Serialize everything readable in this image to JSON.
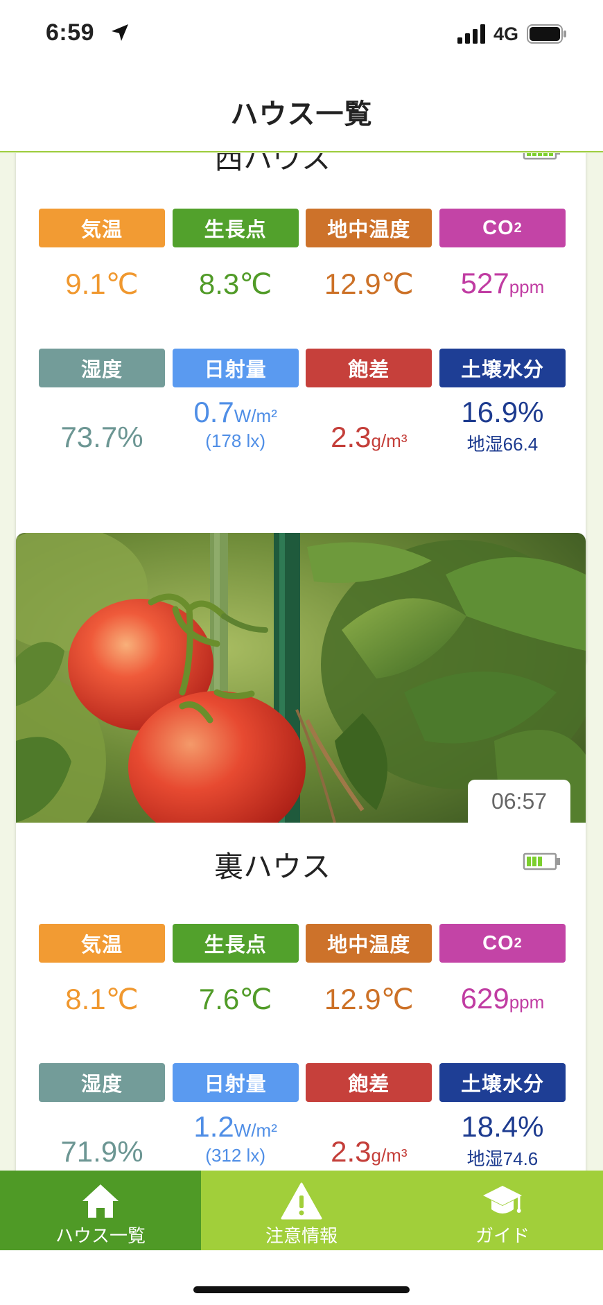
{
  "status_bar": {
    "time": "6:59",
    "network": "4G"
  },
  "header": {
    "title": "ハウス一覧"
  },
  "houses": [
    {
      "name": "西ハウス",
      "battery_level": 1.0,
      "labels": {
        "air_temp": "気温",
        "growth_point": "生長点",
        "ground_temp": "地中温度",
        "co2": "CO",
        "co2_sub": "2",
        "humidity": "湿度",
        "solar": "日射量",
        "saturation": "飽差",
        "soil_moisture": "土壌水分"
      },
      "values": {
        "air_temp": "9.1℃",
        "growth_point": "8.3℃",
        "ground_temp": "12.9℃",
        "co2": "527",
        "co2_unit": "ppm",
        "humidity": "73.7%",
        "solar": "0.7",
        "solar_unit": "W/m²",
        "solar_lux": "(178 lx)",
        "saturation": "2.3",
        "saturation_unit": "g/m³",
        "soil_moisture": "16.9%",
        "soil_sub": "地湿66.4"
      }
    },
    {
      "name": "裏ハウス",
      "battery_level": 0.6,
      "photo_time": "06:57",
      "labels": {
        "air_temp": "気温",
        "growth_point": "生長点",
        "ground_temp": "地中温度",
        "co2": "CO",
        "co2_sub": "2",
        "humidity": "湿度",
        "solar": "日射量",
        "saturation": "飽差",
        "soil_moisture": "土壌水分"
      },
      "values": {
        "air_temp": "8.1℃",
        "growth_point": "7.6℃",
        "ground_temp": "12.9℃",
        "co2": "629",
        "co2_unit": "ppm",
        "humidity": "71.9%",
        "solar": "1.2",
        "solar_unit": "W/m²",
        "solar_lux": "(312 lx)",
        "saturation": "2.3",
        "saturation_unit": "g/m³",
        "soil_moisture": "18.4%",
        "soil_sub": "地湿74.6"
      }
    }
  ],
  "tabs": [
    {
      "label": "ハウス一覧",
      "icon": "home-icon",
      "active": true
    },
    {
      "label": "注意情報",
      "icon": "warning-icon",
      "active": false
    },
    {
      "label": "ガイド",
      "icon": "graduation-cap-icon",
      "active": false
    }
  ],
  "colors": {
    "brand_green": "#4f9a26",
    "tab_bar": "#a1cf3a",
    "air_temp": "#f29b33",
    "growth_point": "#52a12c",
    "ground_temp": "#cd722a",
    "co2": "#c344a6",
    "humidity": "#739c99",
    "solar": "#5a9af0",
    "saturation": "#c6403b",
    "soil_moisture": "#1e3e95"
  }
}
